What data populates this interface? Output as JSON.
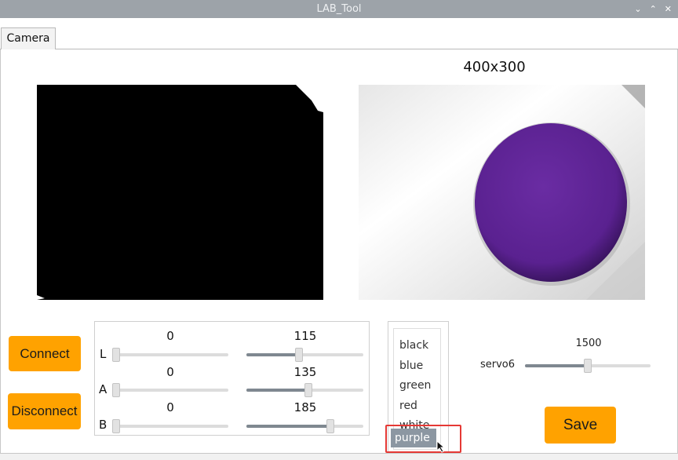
{
  "window": {
    "title": "LAB_Tool",
    "controls": {
      "minimize": "⌄",
      "maximize": "⌃",
      "close": "✕"
    }
  },
  "tabs": [
    {
      "label": "Camera",
      "active": true
    }
  ],
  "camera": {
    "resolution_label": "400x300"
  },
  "buttons": {
    "connect": "Connect",
    "disconnect": "Disconnect",
    "save": "Save"
  },
  "lab_sliders": [
    {
      "axis": "L",
      "min_value": "0",
      "max_value": "115",
      "min_fraction": 0.0,
      "max_fraction": 0.45
    },
    {
      "axis": "A",
      "min_value": "0",
      "max_value": "135",
      "min_fraction": 0.0,
      "max_fraction": 0.53
    },
    {
      "axis": "B",
      "min_value": "0",
      "max_value": "185",
      "min_fraction": 0.0,
      "max_fraction": 0.72
    }
  ],
  "color_list": {
    "items": [
      "black",
      "blue",
      "green",
      "red",
      "white"
    ],
    "selected": "purple"
  },
  "servo": {
    "label": "servo6",
    "value": "1500",
    "fraction": 0.5
  },
  "colors": {
    "accent": "#ffa200",
    "selection": "#8c97a2",
    "highlight": "#e53935",
    "titlebar": "#9da3a9"
  }
}
